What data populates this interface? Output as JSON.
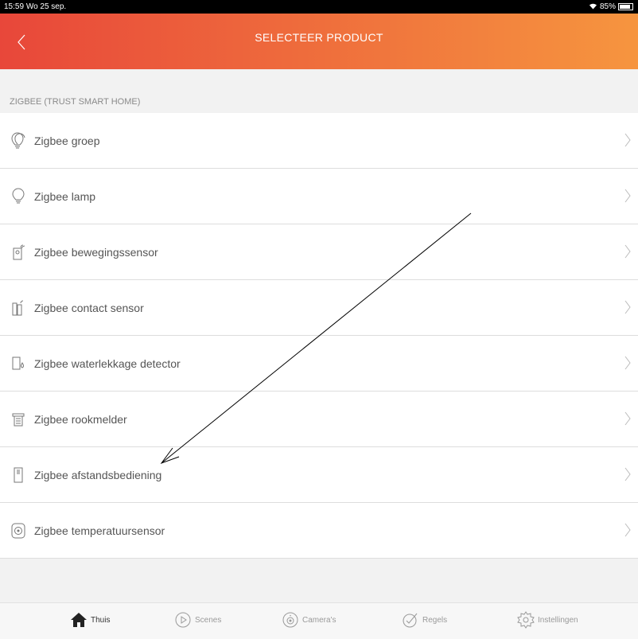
{
  "status_bar": {
    "time": "15:59",
    "date": "Wo 25 sep.",
    "battery": "85%",
    "battery_level": 0.85
  },
  "nav": {
    "title": "SELECTEER PRODUCT",
    "back_icon": "chevron-left-icon"
  },
  "section": {
    "header": "ZIGBEE (TRUST SMART HOME)",
    "items": [
      {
        "label": "Zigbee groep",
        "icon": "bulb-group-icon"
      },
      {
        "label": "Zigbee lamp",
        "icon": "bulb-icon"
      },
      {
        "label": "Zigbee bewegingssensor",
        "icon": "motion-sensor-icon"
      },
      {
        "label": "Zigbee contact sensor",
        "icon": "contact-sensor-icon"
      },
      {
        "label": "Zigbee waterlekkage detector",
        "icon": "water-leak-icon"
      },
      {
        "label": "Zigbee rookmelder",
        "icon": "smoke-detector-icon"
      },
      {
        "label": "Zigbee afstandsbediening",
        "icon": "remote-control-icon"
      },
      {
        "label": "Zigbee temperatuursensor",
        "icon": "temperature-sensor-icon"
      }
    ]
  },
  "tabs": [
    {
      "label": "Thuis",
      "icon": "home-icon",
      "active": true
    },
    {
      "label": "Scenes",
      "icon": "play-circle-icon",
      "active": false
    },
    {
      "label": "Camera's",
      "icon": "camera-icon",
      "active": false
    },
    {
      "label": "Regels",
      "icon": "rules-icon",
      "active": false
    },
    {
      "label": "Instellingen",
      "icon": "gear-icon",
      "active": false
    }
  ],
  "colors": {
    "header_start": "#e8473a",
    "header_end": "#f6953f",
    "background": "#f2f2f2"
  }
}
